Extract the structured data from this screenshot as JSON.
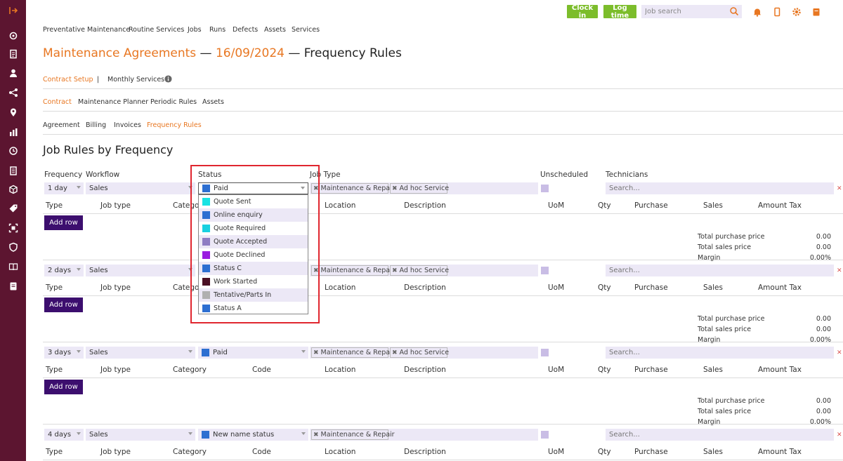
{
  "header": {
    "clock_in": "Clock in",
    "log_time": "Log time",
    "job_search_placeholder": "Job search"
  },
  "nav": [
    "Preventative Maintenance",
    "Routine Services",
    "Jobs",
    "Runs",
    "Defects",
    "Assets",
    "Services"
  ],
  "title": {
    "part1": "Maintenance Agreements",
    "sep1": " — ",
    "date": "16/09/2024",
    "sep2": " — ",
    "part3": "Frequency Rules"
  },
  "tabs1": {
    "a": "Contract Setup",
    "sep": "|",
    "b": "Monthly Services"
  },
  "tabs2": [
    "Contract",
    "Maintenance Planner",
    "Periodic Rules",
    "Assets"
  ],
  "tabs3": [
    "Agreement",
    "Billing",
    "Invoices",
    "Frequency Rules"
  ],
  "section_title": "Job Rules by Frequency",
  "columns": [
    "Frequency",
    "Workflow",
    "Status",
    "Job Type",
    "Unscheduled",
    "Technicians"
  ],
  "subcols": [
    "Type",
    "Job type",
    "Category",
    "Code",
    "Location",
    "Description",
    "UoM",
    "Qty",
    "Purchase",
    "Sales",
    "Amount Tax"
  ],
  "add_row": "Add row",
  "totals": {
    "purchase_label": "Total purchase price",
    "sales_label": "Total sales price",
    "margin_label": "Margin",
    "purchase": "0.00",
    "sales": "0.00",
    "margin": "0.00%"
  },
  "search_placeholder": "Search...",
  "rows": [
    {
      "freq": "1 day",
      "workflow": "Sales",
      "status": "Paid",
      "status_color": "#2d6fd1",
      "job_types": [
        "Maintenance & Repair",
        "Ad hoc Service"
      ]
    },
    {
      "freq": "2 days",
      "workflow": "Sales",
      "status": "",
      "status_color": "",
      "job_types": [
        "Maintenance & Repair",
        "Ad hoc Service"
      ]
    },
    {
      "freq": "3 days",
      "workflow": "Sales",
      "status": "Paid",
      "status_color": "#2d6fd1",
      "job_types": [
        "Maintenance & Repair",
        "Ad hoc Service"
      ]
    },
    {
      "freq": "4 days",
      "workflow": "Sales",
      "status": "New name status",
      "status_color": "#2d6fd1",
      "job_types": [
        "Maintenance & Repair"
      ]
    }
  ],
  "dropdown": [
    {
      "label": "Quote Sent",
      "color": "#19e3e3"
    },
    {
      "label": "Online enquiry",
      "color": "#2d6fd1"
    },
    {
      "label": "Quote Required",
      "color": "#19d0e0"
    },
    {
      "label": "Quote Accepted",
      "color": "#8e7cc3"
    },
    {
      "label": "Quote Declined",
      "color": "#9b1ee0"
    },
    {
      "label": "Status C",
      "color": "#2d6fd1"
    },
    {
      "label": "Work Started",
      "color": "#4a0f24"
    },
    {
      "label": "Tentative/Parts In",
      "color": "#b0b0b0"
    },
    {
      "label": "Status A",
      "color": "#2d6fd1"
    }
  ],
  "colors": {
    "sidebar": "#5c1530",
    "accent": "#e87722",
    "button_green": "#7cbd2b",
    "add_row": "#3c0e6e",
    "highlight": "#e0262f"
  }
}
